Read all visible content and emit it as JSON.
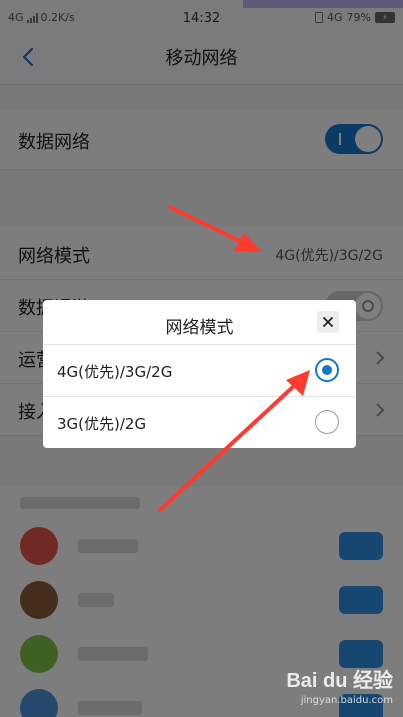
{
  "status_bar": {
    "network": "4G",
    "speed": "0.2K/s",
    "time": "14:32",
    "right_network": "4G",
    "battery": "79%"
  },
  "header": {
    "title": "移动网络"
  },
  "settings": {
    "data_network": {
      "label": "数据网络",
      "toggle_on": true
    },
    "network_mode": {
      "label": "网络模式",
      "value": "4G(优先)/3G/2G"
    },
    "data_roaming": {
      "label": "数据漫游",
      "toggle_on": false
    },
    "carrier": {
      "label": "运营商"
    },
    "access_point": {
      "label": "接入点"
    }
  },
  "dialog": {
    "title": "网络模式",
    "options": [
      {
        "label": "4G(优先)/3G/2G",
        "selected": true
      },
      {
        "label": "3G(优先)/2G",
        "selected": false
      }
    ]
  },
  "watermark": {
    "logo": "Bai du 经验",
    "url": "jingyan.baidu.com"
  },
  "colors": {
    "accent": "#1677c8",
    "arrow": "#ff3b30",
    "app_button": "#2d8fe0"
  }
}
